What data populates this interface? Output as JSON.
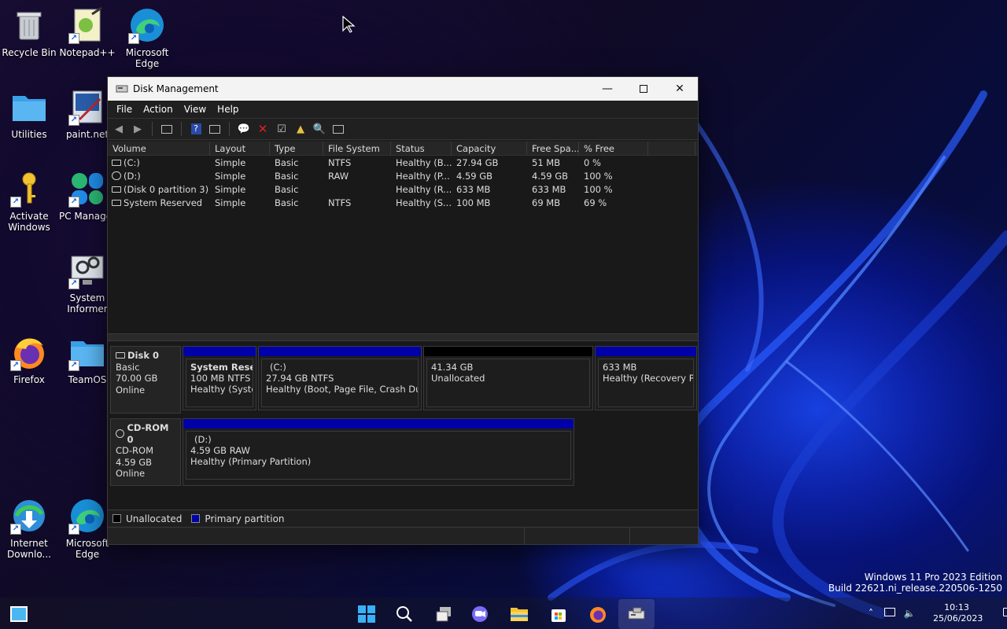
{
  "desktop": {
    "icons": [
      {
        "label": "Recycle Bin"
      },
      {
        "label": "Notepad++"
      },
      {
        "label": "Microsoft\nEdge"
      },
      {
        "label": "Utilities"
      },
      {
        "label": "paint.net"
      },
      {
        "label": "Activate\nWindows"
      },
      {
        "label": "PC Manager"
      },
      {
        "label": "System\nInformer"
      },
      {
        "label": "Firefox"
      },
      {
        "label": "TeamOS"
      },
      {
        "label": "Internet\nDownlo..."
      },
      {
        "label": "Microsoft\nEdge"
      }
    ],
    "watermark_line1": "Windows 11 Pro 2023 Edition",
    "watermark_line2": "Build 22621.ni_release.220506-1250"
  },
  "window": {
    "title": "Disk Management",
    "menu": [
      "File",
      "Action",
      "View",
      "Help"
    ],
    "columns": [
      "Volume",
      "Layout",
      "Type",
      "File System",
      "Status",
      "Capacity",
      "Free Spa...",
      "% Free"
    ],
    "volumes": [
      {
        "volume": "(C:)",
        "layout": "Simple",
        "type": "Basic",
        "fs": "NTFS",
        "status": "Healthy (B...",
        "capacity": "27.94 GB",
        "free": "51 MB",
        "pct": "0 %"
      },
      {
        "volume": "(D:)",
        "layout": "Simple",
        "type": "Basic",
        "fs": "RAW",
        "status": "Healthy (P...",
        "capacity": "4.59 GB",
        "free": "4.59 GB",
        "pct": "100 %"
      },
      {
        "volume": "(Disk 0 partition 3)",
        "layout": "Simple",
        "type": "Basic",
        "fs": "",
        "status": "Healthy (R...",
        "capacity": "633 MB",
        "free": "633 MB",
        "pct": "100 %"
      },
      {
        "volume": "System Reserved",
        "layout": "Simple",
        "type": "Basic",
        "fs": "NTFS",
        "status": "Healthy (S...",
        "capacity": "100 MB",
        "free": "69 MB",
        "pct": "69 %"
      }
    ],
    "disks": [
      {
        "name": "Disk 0",
        "type": "Basic",
        "size": "70.00 GB",
        "state": "Online",
        "partitions": [
          {
            "name": "System Reserve",
            "detail": "100 MB NTFS",
            "status": "Healthy (Syster"
          },
          {
            "name": "(C:)",
            "detail": "27.94 GB NTFS",
            "status": "Healthy (Boot, Page File, Crash Dump"
          },
          {
            "name": "",
            "detail": "41.34 GB",
            "status": "Unallocated"
          },
          {
            "name": "",
            "detail": "633 MB",
            "status": "Healthy (Recovery Part"
          }
        ]
      },
      {
        "name": "CD-ROM 0",
        "type": "CD-ROM",
        "size": "4.59 GB",
        "state": "Online",
        "partitions": [
          {
            "name": "(D:)",
            "detail": "4.59 GB RAW",
            "status": "Healthy (Primary Partition)"
          }
        ]
      }
    ],
    "legend": [
      "Unallocated",
      "Primary partition"
    ]
  },
  "taskbar": {
    "time": "10:13",
    "date": "25/06/2023"
  },
  "colors": {
    "primary_partition": "#0000a8",
    "unallocated": "#000000"
  }
}
